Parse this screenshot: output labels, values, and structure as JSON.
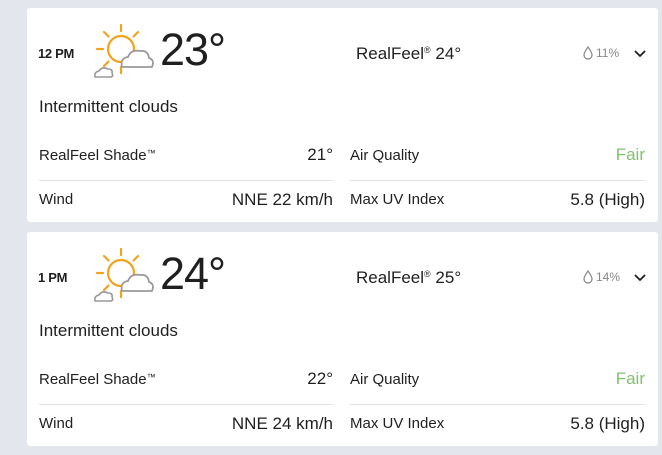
{
  "hours": [
    {
      "time": "12 PM",
      "icon": "intermittent-clouds-icon",
      "temp": "23°",
      "realfeel_label": "RealFeel",
      "realfeel_mark": "®",
      "realfeel_value": " 24°",
      "precip": "11%",
      "phrase": "Intermittent clouds",
      "details": {
        "realfeel_shade_label": "RealFeel Shade",
        "realfeel_shade_mark": "™",
        "realfeel_shade_value": "21°",
        "air_quality_label": "Air Quality",
        "air_quality_value": "Fair",
        "wind_label": "Wind",
        "wind_value": "NNE 22 km/h",
        "uv_label": "Max UV Index",
        "uv_value": "5.8 (High)"
      }
    },
    {
      "time": "1 PM",
      "icon": "intermittent-clouds-icon",
      "temp": "24°",
      "realfeel_label": "RealFeel",
      "realfeel_mark": "®",
      "realfeel_value": " 25°",
      "precip": "14%",
      "phrase": "Intermittent clouds",
      "details": {
        "realfeel_shade_label": "RealFeel Shade",
        "realfeel_shade_mark": "™",
        "realfeel_shade_value": "22°",
        "air_quality_label": "Air Quality",
        "air_quality_value": "Fair",
        "wind_label": "Wind",
        "wind_value": "NNE 24 km/h",
        "uv_label": "Max UV Index",
        "uv_value": "5.8 (High)"
      }
    }
  ],
  "colors": {
    "background": "#e3e6ec",
    "card": "#ffffff",
    "sun": "#f4a21d",
    "cloud": "#9a9a9a",
    "fair": "#82c06f",
    "muted": "#878787"
  }
}
